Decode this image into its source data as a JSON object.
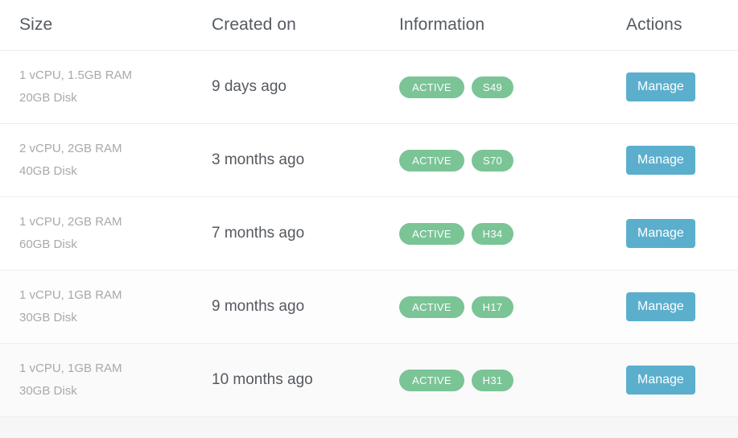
{
  "table": {
    "columns": [
      {
        "key": "size",
        "label": "Size"
      },
      {
        "key": "created",
        "label": "Created on"
      },
      {
        "key": "info",
        "label": "Information"
      },
      {
        "key": "actions",
        "label": "Actions"
      }
    ],
    "action_label": "Manage",
    "rows": [
      {
        "size_specs": "1 vCPU, 1.5GB RAM",
        "size_disk": "20GB Disk",
        "created": "9 days ago",
        "status": "ACTIVE",
        "region": "S49",
        "action": "Manage"
      },
      {
        "size_specs": "2 vCPU, 2GB RAM",
        "size_disk": "40GB Disk",
        "created": "3 months ago",
        "status": "ACTIVE",
        "region": "S70",
        "action": "Manage"
      },
      {
        "size_specs": "1 vCPU, 2GB RAM",
        "size_disk": "60GB Disk",
        "created": "7 months ago",
        "status": "ACTIVE",
        "region": "H34",
        "action": "Manage"
      },
      {
        "size_specs": "1 vCPU, 1GB RAM",
        "size_disk": "30GB Disk",
        "created": "9 months ago",
        "status": "ACTIVE",
        "region": "H17",
        "action": "Manage"
      },
      {
        "size_specs": "1 vCPU, 1GB RAM",
        "size_disk": "30GB Disk",
        "created": "10 months ago",
        "status": "ACTIVE",
        "region": "H31",
        "action": "Manage"
      }
    ]
  },
  "colors": {
    "status_badge": "#7bc496",
    "region_badge": "#7bc496",
    "manage_button": "#5bafcd",
    "header_text": "#555b62",
    "size_text": "#a9a9a9",
    "created_text": "#55595f",
    "row_border": "#eeeeee",
    "footer": "#f6f6f6"
  }
}
